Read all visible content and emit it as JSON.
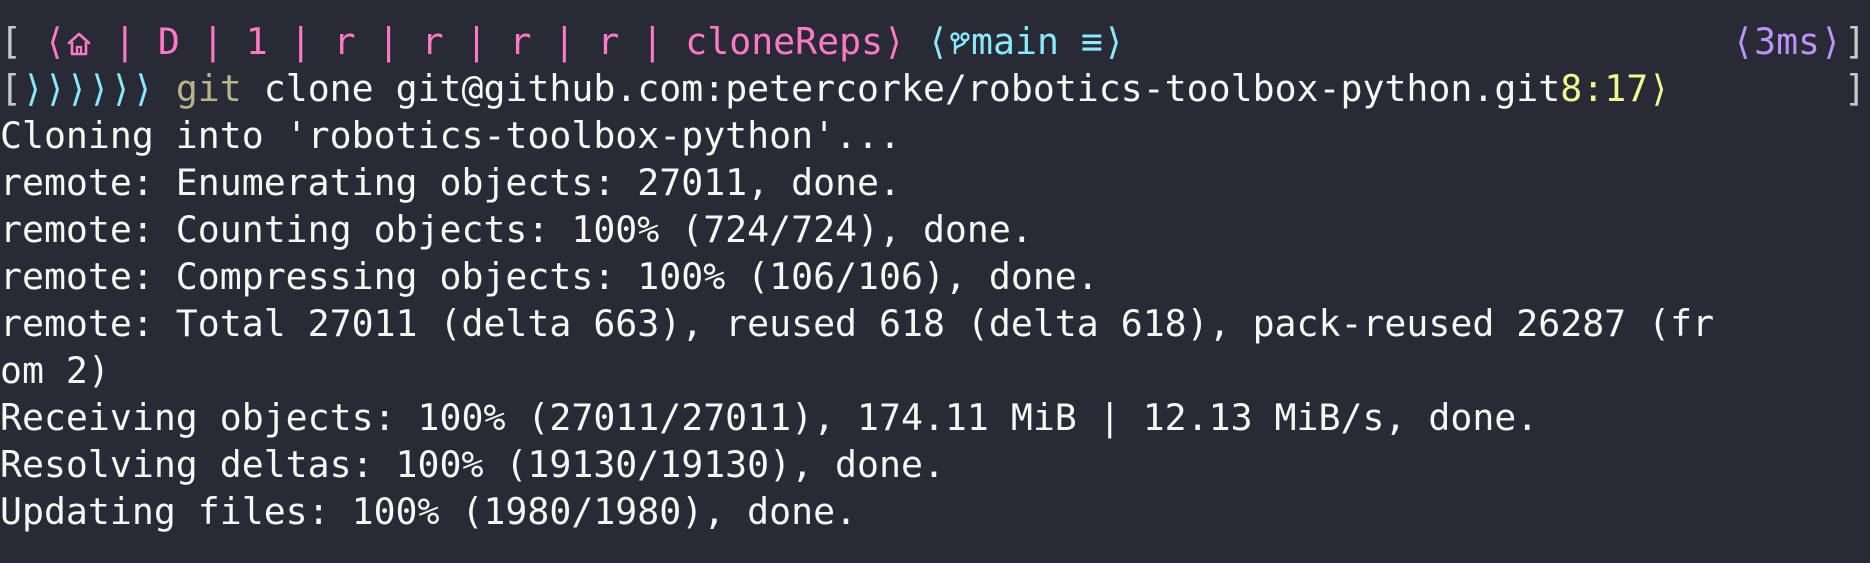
{
  "prompt": {
    "open_bracket": "[",
    "path_open": "⟨",
    "path_segments_text": " | D | 1 | r | r | r | r | cloneReps",
    "path_close": "⟩",
    "git_open": "⟨",
    "branch": "main",
    "git_status": "≡",
    "git_close": "⟩",
    "duration": "⟨3ms⟩",
    "close_bracket": "]",
    "line2_open_bracket": "[",
    "arrows": "⟩⟩⟩⟩⟩⟩",
    "command_git": "git",
    "command_rest": " clone git@github.com:petercorke/robotics-toolbox-python.git",
    "clock": "8:17",
    "clock_close": "⟩",
    "line2_close_bracket": "]"
  },
  "output": [
    "Cloning into 'robotics-toolbox-python'...",
    "remote: Enumerating objects: 27011, done.",
    "remote: Counting objects: 100% (724/724), done.",
    "remote: Compressing objects: 100% (106/106), done.",
    "remote: Total 27011 (delta 663), reused 618 (delta 618), pack-reused 26287 (fr",
    "om 2)",
    "Receiving objects: 100% (27011/27011), 174.11 MiB | 12.13 MiB/s, done.",
    "Resolving deltas: 100% (19130/19130), done.",
    "Updating files: 100% (1980/1980), done."
  ],
  "colors": {
    "background": "#282a36",
    "path": "#ff79c6",
    "git": "#8be9fd",
    "duration": "#bd93f9",
    "clock": "#f1fa8c",
    "text": "#f8f8f2"
  },
  "icons": {
    "home": "home-icon",
    "branch": "git-branch-icon"
  }
}
